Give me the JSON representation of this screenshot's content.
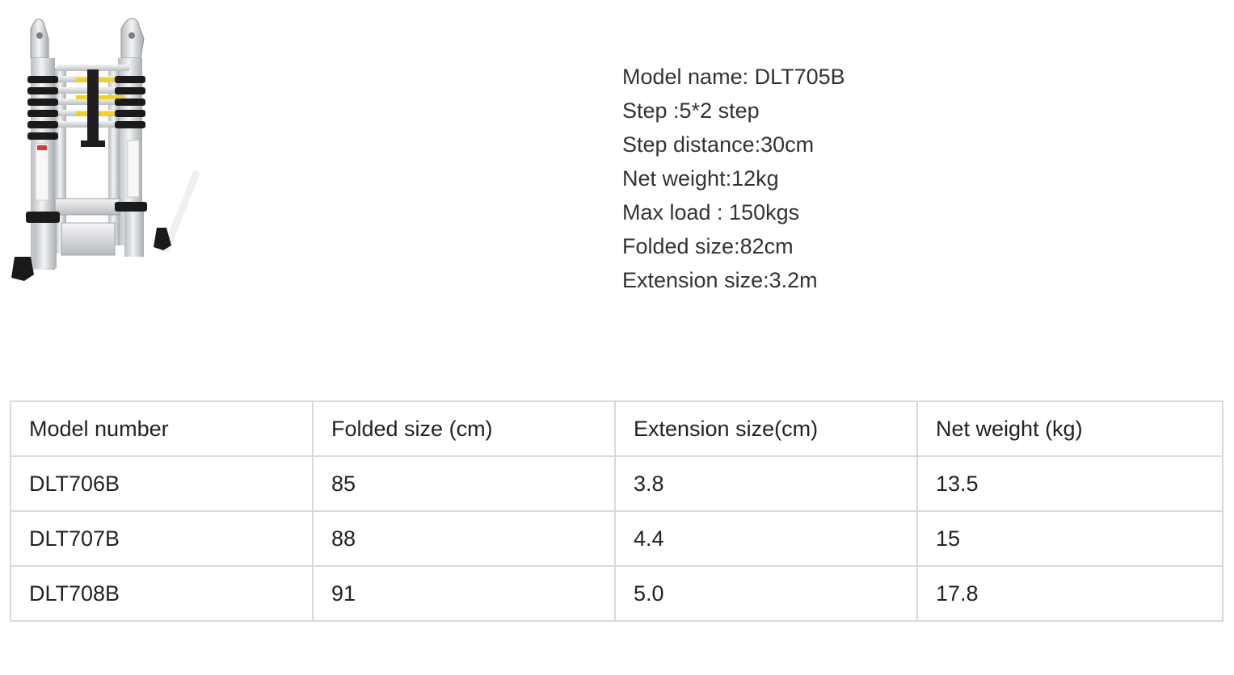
{
  "product_image": {
    "icon": "telescopic-ladder-image",
    "colors": {
      "aluminum": "#d9dcdf",
      "black_band": "#1a1a1a",
      "label_yellow": "#f2d21a",
      "label_red": "#d83a2e"
    }
  },
  "specs": [
    "Model name: DLT705B",
    "Step :5*2 step",
    "Step distance:30cm",
    "Net weight:12kg",
    "Max load : 150kgs",
    "Folded size:82cm",
    "Extension size:3.2m"
  ],
  "table": {
    "headers": [
      "Model number",
      "Folded size (cm)",
      "Extension size(cm)",
      "Net weight (kg)"
    ],
    "rows": [
      [
        "DLT706B",
        "85",
        "3.8",
        "13.5"
      ],
      [
        "DLT707B",
        "88",
        "4.4",
        "15"
      ],
      [
        "DLT708B",
        "91",
        "5.0",
        "17.8"
      ]
    ]
  }
}
